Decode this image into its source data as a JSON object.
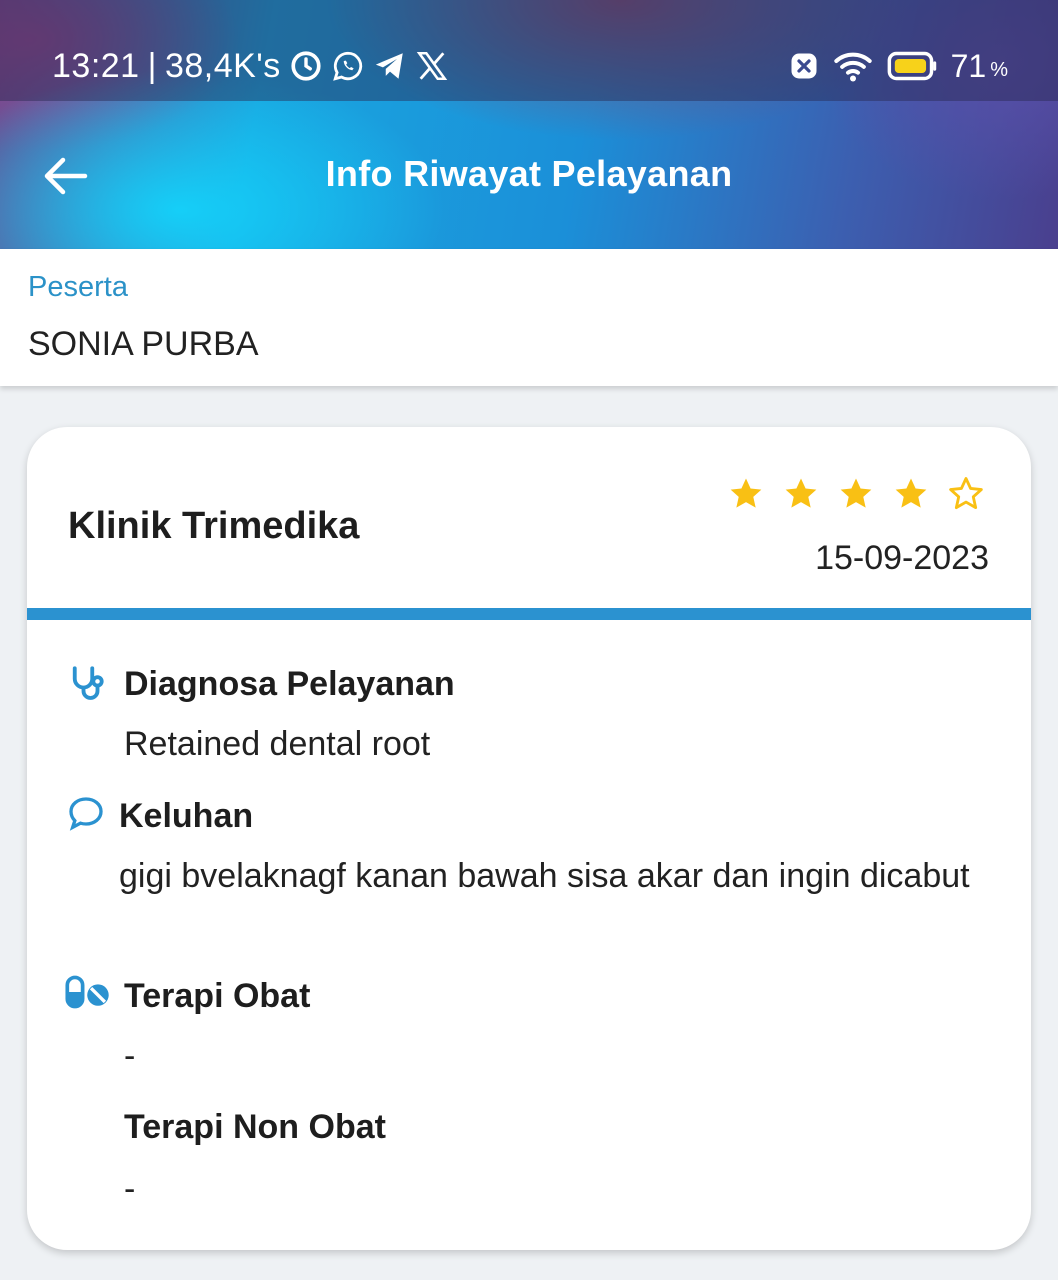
{
  "status_bar": {
    "time": "13:21",
    "separator": "|",
    "network_speed": "38,4K's",
    "left_icons": [
      "alarm-icon",
      "whatsapp-icon",
      "telegram-icon",
      "x-icon"
    ],
    "right_icons": [
      "no-sim-icon",
      "wifi-icon",
      "battery-icon"
    ],
    "battery_percent": "71",
    "battery_unit": "%"
  },
  "app_bar": {
    "title": "Info Riwayat Pelayanan",
    "back_icon": "arrow-left-icon"
  },
  "participant": {
    "label": "Peserta",
    "name": "SONIA PURBA"
  },
  "visit": {
    "clinic": "Klinik Trimedika",
    "rating": 4,
    "rating_max": 5,
    "date": "15-09-2023",
    "sections": [
      {
        "icon": "stethoscope-icon",
        "title": "Diagnosa Pelayanan",
        "value": "Retained dental root"
      },
      {
        "icon": "chat-bubble-icon",
        "title": "Keluhan",
        "value": "gigi bvelaknagf kanan bawah sisa akar dan ingin dicabut"
      },
      {
        "icon": "pills-icon",
        "title": "Terapi Obat",
        "value": "-"
      },
      {
        "icon": "",
        "title": "Terapi Non Obat",
        "value": "-"
      }
    ]
  },
  "colors": {
    "accent": "#2b92d0",
    "label_blue": "#2b92c8",
    "star": "#f9c014",
    "icon_blue": "#2b92d0"
  }
}
